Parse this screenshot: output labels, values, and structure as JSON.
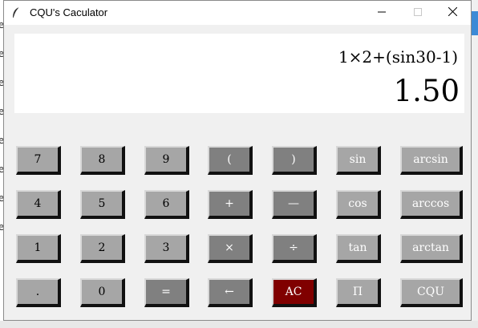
{
  "window": {
    "title": "CQU's Caculator"
  },
  "display": {
    "expression": "1×2+(sin30-1)",
    "result": "1.50"
  },
  "keys": {
    "row1": [
      "7",
      "8",
      "9",
      "(",
      ")",
      "sin",
      "arcsin"
    ],
    "row2": [
      "4",
      "5",
      "6",
      "+",
      "—",
      "cos",
      "arccos"
    ],
    "row3": [
      "1",
      "2",
      "3",
      "×",
      "÷",
      "tan",
      "arctan"
    ],
    "row4": [
      ".",
      "0",
      "=",
      "←",
      "AC",
      "Π",
      "CQU"
    ]
  },
  "background": {
    "left_fragments": [
      "e",
      "e",
      "e",
      "e",
      "e",
      "e",
      "e",
      "e"
    ]
  },
  "colors": {
    "digit_key": "#a6a6a6",
    "operator_key": "#808080",
    "clear_key": "#800000",
    "display_bg": "#ffffff",
    "window_bg": "#f0f0f0"
  },
  "icons": {
    "app": "feather-icon",
    "minimize": "minimize-icon",
    "maximize": "maximize-icon",
    "close": "close-icon"
  }
}
